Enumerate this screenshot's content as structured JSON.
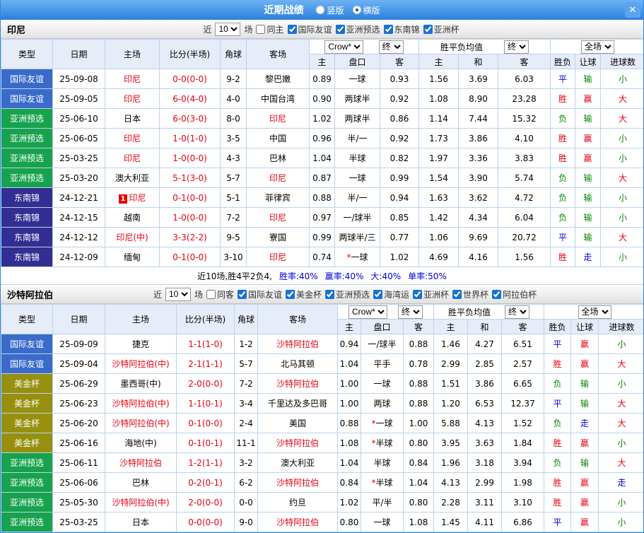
{
  "titlebar": {
    "title": "近期战绩",
    "radio_vertical": "竖版",
    "radio_horizontal": "横版",
    "close": "✕"
  },
  "colors": {
    "accent_blue": "#2f86e3",
    "focal_team": "#e60012",
    "win": "#e60012",
    "draw": "#0000dc",
    "loss": "#008800",
    "result_map": {
      "胜": "win",
      "赢": "win",
      "大": "win",
      "平": "draw",
      "走": "draw",
      "负": "loss",
      "输": "loss",
      "小": "loss"
    },
    "league_colors": {
      "国际友谊": "#3A6BC9",
      "亚洲预选": "#17A24D",
      "东南锦": "#322E92",
      "美金杯": "#97900E"
    }
  },
  "sections": [
    {
      "team": "印尼",
      "filter": {
        "near": "近",
        "count": "10",
        "games": "场",
        "same": "同主",
        "leagues": [
          "国际友谊",
          "亚洲预选",
          "东南锦",
          "亚洲杯"
        ]
      },
      "selects": {
        "company": "Crow*",
        "final1": "终",
        "avg": "胜平负均值",
        "final2": "终",
        "scope": "全场"
      },
      "columns": {
        "type": "类型",
        "date": "日期",
        "home": "主场",
        "score": "比分(半场)",
        "corner": "角球",
        "away": "客场",
        "sub": [
          "主",
          "盘口",
          "客",
          "主",
          "和",
          "客",
          "胜负",
          "让球",
          "进球数"
        ]
      },
      "rows": [
        {
          "type": "国际友谊",
          "date": "25-09-08",
          "home": "印尼",
          "home_focal": true,
          "score": "0-0(0-0)",
          "corner": "9-2",
          "away": "黎巴嫩",
          "odds": [
            "0.89",
            "一球",
            "0.93"
          ],
          "avg": [
            "1.56",
            "3.69",
            "6.03"
          ],
          "results": [
            "平",
            "输",
            "小"
          ]
        },
        {
          "type": "国际友谊",
          "date": "25-09-05",
          "home": "印尼",
          "home_focal": true,
          "score": "6-0(4-0)",
          "corner": "4-0",
          "away": "中国台湾",
          "odds": [
            "0.90",
            "两球半",
            "0.92"
          ],
          "avg": [
            "1.08",
            "8.90",
            "23.28"
          ],
          "results": [
            "胜",
            "赢",
            "大"
          ]
        },
        {
          "type": "亚洲预选",
          "date": "25-06-10",
          "home": "日本",
          "score": "6-0(3-0)",
          "corner": "8-0",
          "away": "印尼",
          "away_focal": true,
          "odds": [
            "1.02",
            "两球半",
            "0.86"
          ],
          "avg": [
            "1.14",
            "7.44",
            "15.32"
          ],
          "results": [
            "负",
            "输",
            "大"
          ]
        },
        {
          "type": "亚洲预选",
          "date": "25-06-05",
          "home": "印尼",
          "home_focal": true,
          "score": "1-0(1-0)",
          "corner": "3-5",
          "away": "中国",
          "odds": [
            "0.96",
            "半/一",
            "0.92"
          ],
          "avg": [
            "1.73",
            "3.86",
            "4.10"
          ],
          "results": [
            "胜",
            "赢",
            "小"
          ]
        },
        {
          "type": "亚洲预选",
          "date": "25-03-25",
          "home": "印尼",
          "home_focal": true,
          "score": "1-0(0-0)",
          "corner": "4-3",
          "away": "巴林",
          "odds": [
            "1.04",
            "半球",
            "0.82"
          ],
          "avg": [
            "1.97",
            "3.36",
            "3.83"
          ],
          "results": [
            "胜",
            "赢",
            "小"
          ]
        },
        {
          "type": "亚洲预选",
          "date": "25-03-20",
          "home": "澳大利亚",
          "score": "5-1(3-0)",
          "corner": "5-7",
          "away": "印尼",
          "away_focal": true,
          "odds": [
            "0.87",
            "一球",
            "0.99"
          ],
          "avg": [
            "1.54",
            "3.90",
            "5.74"
          ],
          "results": [
            "负",
            "输",
            "大"
          ]
        },
        {
          "type": "东南锦",
          "date": "24-12-21",
          "home": "印尼",
          "home_focal": true,
          "home_redcard": "1",
          "score": "0-1(0-0)",
          "corner": "5-1",
          "away": "菲律宾",
          "odds": [
            "0.88",
            "半/一",
            "0.94"
          ],
          "avg": [
            "1.63",
            "3.62",
            "4.72"
          ],
          "results": [
            "负",
            "输",
            "小"
          ]
        },
        {
          "type": "东南锦",
          "date": "24-12-15",
          "home": "越南",
          "score": "1-0(0-0)",
          "corner": "7-2",
          "away": "印尼",
          "away_focal": true,
          "odds": [
            "0.97",
            "一/球半",
            "0.85"
          ],
          "avg": [
            "1.42",
            "4.34",
            "6.04"
          ],
          "results": [
            "负",
            "输",
            "小"
          ]
        },
        {
          "type": "东南锦",
          "date": "24-12-12",
          "home": "印尼(中)",
          "home_focal": true,
          "score": "3-3(2-2)",
          "corner": "9-5",
          "away": "寮国",
          "odds": [
            "0.99",
            "两球半/三",
            "0.77"
          ],
          "avg": [
            "1.06",
            "9.69",
            "20.72"
          ],
          "results": [
            "平",
            "输",
            "大"
          ]
        },
        {
          "type": "东南锦",
          "date": "24-12-09",
          "home": "缅甸",
          "score": "0-1(0-0)",
          "corner": "3-10",
          "away": "印尼",
          "away_focal": true,
          "odds": [
            "0.74",
            "*一球",
            "1.02"
          ],
          "avg": [
            "4.69",
            "4.16",
            "1.56"
          ],
          "results": [
            "胜",
            "走",
            "小"
          ]
        }
      ],
      "summary": {
        "intro": "近10场,胜4平2负4,",
        "stats": [
          "胜率:40%",
          "赢率:40%",
          "大:40%",
          "单率:50%"
        ]
      }
    },
    {
      "team": "沙特阿拉伯",
      "filter": {
        "near": "近",
        "count": "10",
        "games": "场",
        "same": "同客",
        "leagues": [
          "国际友谊",
          "美金杯",
          "亚洲预选",
          "海湾运",
          "亚洲杯",
          "世界杯",
          "阿拉伯杯"
        ]
      },
      "selects": {
        "company": "Crow*",
        "final1": "终",
        "avg": "胜平负均值",
        "final2": "终",
        "scope": "全场"
      },
      "columns": {
        "type": "类型",
        "date": "日期",
        "home": "主场",
        "score": "比分(半场)",
        "corner": "角球",
        "away": "客场",
        "sub": [
          "主",
          "盘口",
          "客",
          "主",
          "和",
          "客",
          "胜负",
          "让球",
          "进球数"
        ]
      },
      "rows": [
        {
          "type": "国际友谊",
          "date": "25-09-09",
          "home": "捷克",
          "score": "1-1(1-0)",
          "corner": "1-2",
          "away": "沙特阿拉伯",
          "away_focal": true,
          "odds": [
            "0.94",
            "一/球半",
            "0.88"
          ],
          "avg": [
            "1.46",
            "4.27",
            "6.51"
          ],
          "results": [
            "平",
            "赢",
            "小"
          ]
        },
        {
          "type": "国际友谊",
          "date": "25-09-04",
          "home": "沙特阿拉伯(中)",
          "home_focal": true,
          "score": "2-1(1-1)",
          "corner": "5-7",
          "away": "北马其顿",
          "odds": [
            "1.04",
            "平手",
            "0.78"
          ],
          "avg": [
            "2.99",
            "2.85",
            "2.57"
          ],
          "results": [
            "胜",
            "赢",
            "大"
          ]
        },
        {
          "type": "美金杯",
          "date": "25-06-29",
          "home": "墨西哥(中)",
          "score": "2-0(0-0)",
          "corner": "7-2",
          "away": "沙特阿拉伯",
          "away_focal": true,
          "odds": [
            "1.00",
            "一球",
            "0.88"
          ],
          "avg": [
            "1.51",
            "3.86",
            "6.65"
          ],
          "results": [
            "负",
            "输",
            "小"
          ]
        },
        {
          "type": "美金杯",
          "date": "25-06-23",
          "home": "沙特阿拉伯(中)",
          "home_focal": true,
          "score": "1-1(0-1)",
          "corner": "3-4",
          "away": "千里达及多巴哥",
          "odds": [
            "1.00",
            "两球",
            "0.88"
          ],
          "avg": [
            "1.20",
            "6.53",
            "12.37"
          ],
          "results": [
            "平",
            "输",
            "大"
          ]
        },
        {
          "type": "美金杯",
          "date": "25-06-20",
          "home": "沙特阿拉伯(中)",
          "home_focal": true,
          "score": "0-1(0-0)",
          "corner": "2-4",
          "away": "美国",
          "odds": [
            "0.88",
            "*一球",
            "1.00"
          ],
          "avg": [
            "5.88",
            "4.13",
            "1.52"
          ],
          "results": [
            "负",
            "走",
            "大"
          ]
        },
        {
          "type": "美金杯",
          "date": "25-06-16",
          "home": "海地(中)",
          "score": "0-1(0-1)",
          "corner": "11-1",
          "away": "沙特阿拉伯",
          "away_focal": true,
          "odds": [
            "1.08",
            "*半球",
            "0.80"
          ],
          "avg": [
            "3.95",
            "3.63",
            "1.84"
          ],
          "results": [
            "胜",
            "赢",
            "小"
          ]
        },
        {
          "type": "亚洲预选",
          "date": "25-06-11",
          "home": "沙特阿拉伯",
          "home_focal": true,
          "score": "1-2(1-1)",
          "corner": "3-2",
          "away": "澳大利亚",
          "odds": [
            "1.04",
            "半球",
            "0.84"
          ],
          "avg": [
            "1.96",
            "3.18",
            "3.94"
          ],
          "results": [
            "负",
            "输",
            "大"
          ]
        },
        {
          "type": "亚洲预选",
          "date": "25-06-06",
          "home": "巴林",
          "score": "0-2(0-1)",
          "corner": "6-2",
          "away": "沙特阿拉伯",
          "away_focal": true,
          "odds": [
            "0.84",
            "*半球",
            "1.04"
          ],
          "avg": [
            "4.13",
            "2.99",
            "1.98"
          ],
          "results": [
            "胜",
            "赢",
            "走"
          ]
        },
        {
          "type": "亚洲预选",
          "date": "25-05-30",
          "home": "沙特阿拉伯(中)",
          "home_focal": true,
          "score": "2-0(0-0)",
          "corner": "0-0",
          "away": "约旦",
          "odds": [
            "1.02",
            "平/半",
            "0.80"
          ],
          "avg": [
            "2.28",
            "3.11",
            "3.10"
          ],
          "results": [
            "胜",
            "赢",
            "小"
          ]
        },
        {
          "type": "亚洲预选",
          "date": "25-03-25",
          "home": "日本",
          "score": "0-0(0-0)",
          "corner": "9-0",
          "away": "沙特阿拉伯",
          "away_focal": true,
          "odds": [
            "0.80",
            "一球",
            "1.08"
          ],
          "avg": [
            "1.45",
            "4.11",
            "6.86"
          ],
          "results": [
            "平",
            "赢",
            "小"
          ]
        }
      ]
    }
  ]
}
